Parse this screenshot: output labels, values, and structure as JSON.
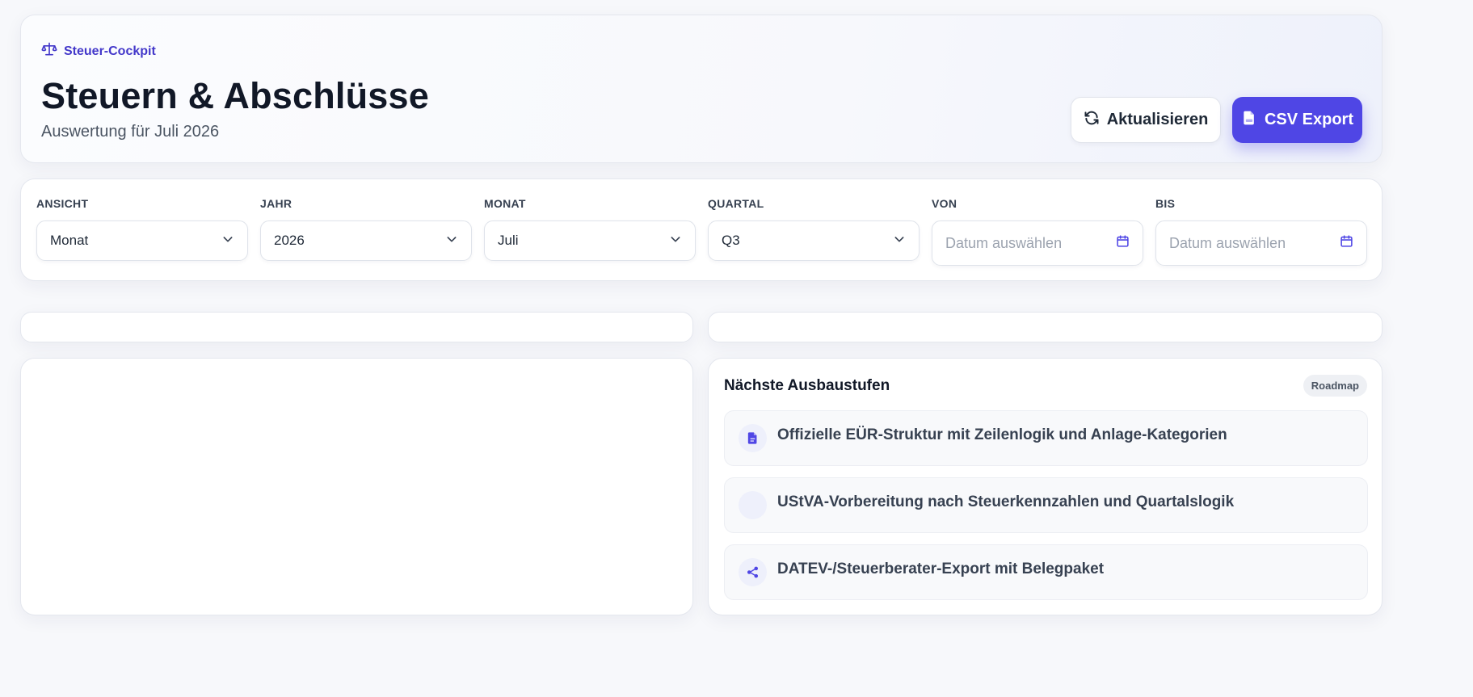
{
  "header": {
    "eyebrow": "Steuer-Cockpit",
    "title": "Steuern & Abschlüsse",
    "subtitle": "Auswertung für Juli 2026",
    "refresh_label": "Aktualisieren",
    "export_label": "CSV Export"
  },
  "filters": [
    {
      "label": "ANSICHT",
      "value": "Monat",
      "kind": "select"
    },
    {
      "label": "JAHR",
      "value": "2026",
      "kind": "select"
    },
    {
      "label": "MONAT",
      "value": "Juli",
      "kind": "select"
    },
    {
      "label": "QUARTAL",
      "value": "Q3",
      "kind": "select"
    },
    {
      "label": "VON",
      "placeholder": "Datum auswählen",
      "kind": "date"
    },
    {
      "label": "BIS",
      "placeholder": "Datum auswählen",
      "kind": "date"
    }
  ],
  "roadmap": {
    "title": "Nächste Ausbaustufen",
    "badge": "Roadmap",
    "items": [
      {
        "text": "Offizielle EÜR-Struktur mit Zeilenlogik und Anlage-Kategorien",
        "icon": "document-icon"
      },
      {
        "text": "UStVA-Vorbereitung nach Steuerkennzahlen und Quartalslogik",
        "icon": "blank-icon"
      },
      {
        "text": "DATEV-/Steuerberater-Export mit Belegpaket",
        "icon": "share-icon"
      }
    ]
  },
  "colors": {
    "accent": "#4f46e5",
    "eyebrow": "#4338ca",
    "background": "#f7f8fb"
  }
}
